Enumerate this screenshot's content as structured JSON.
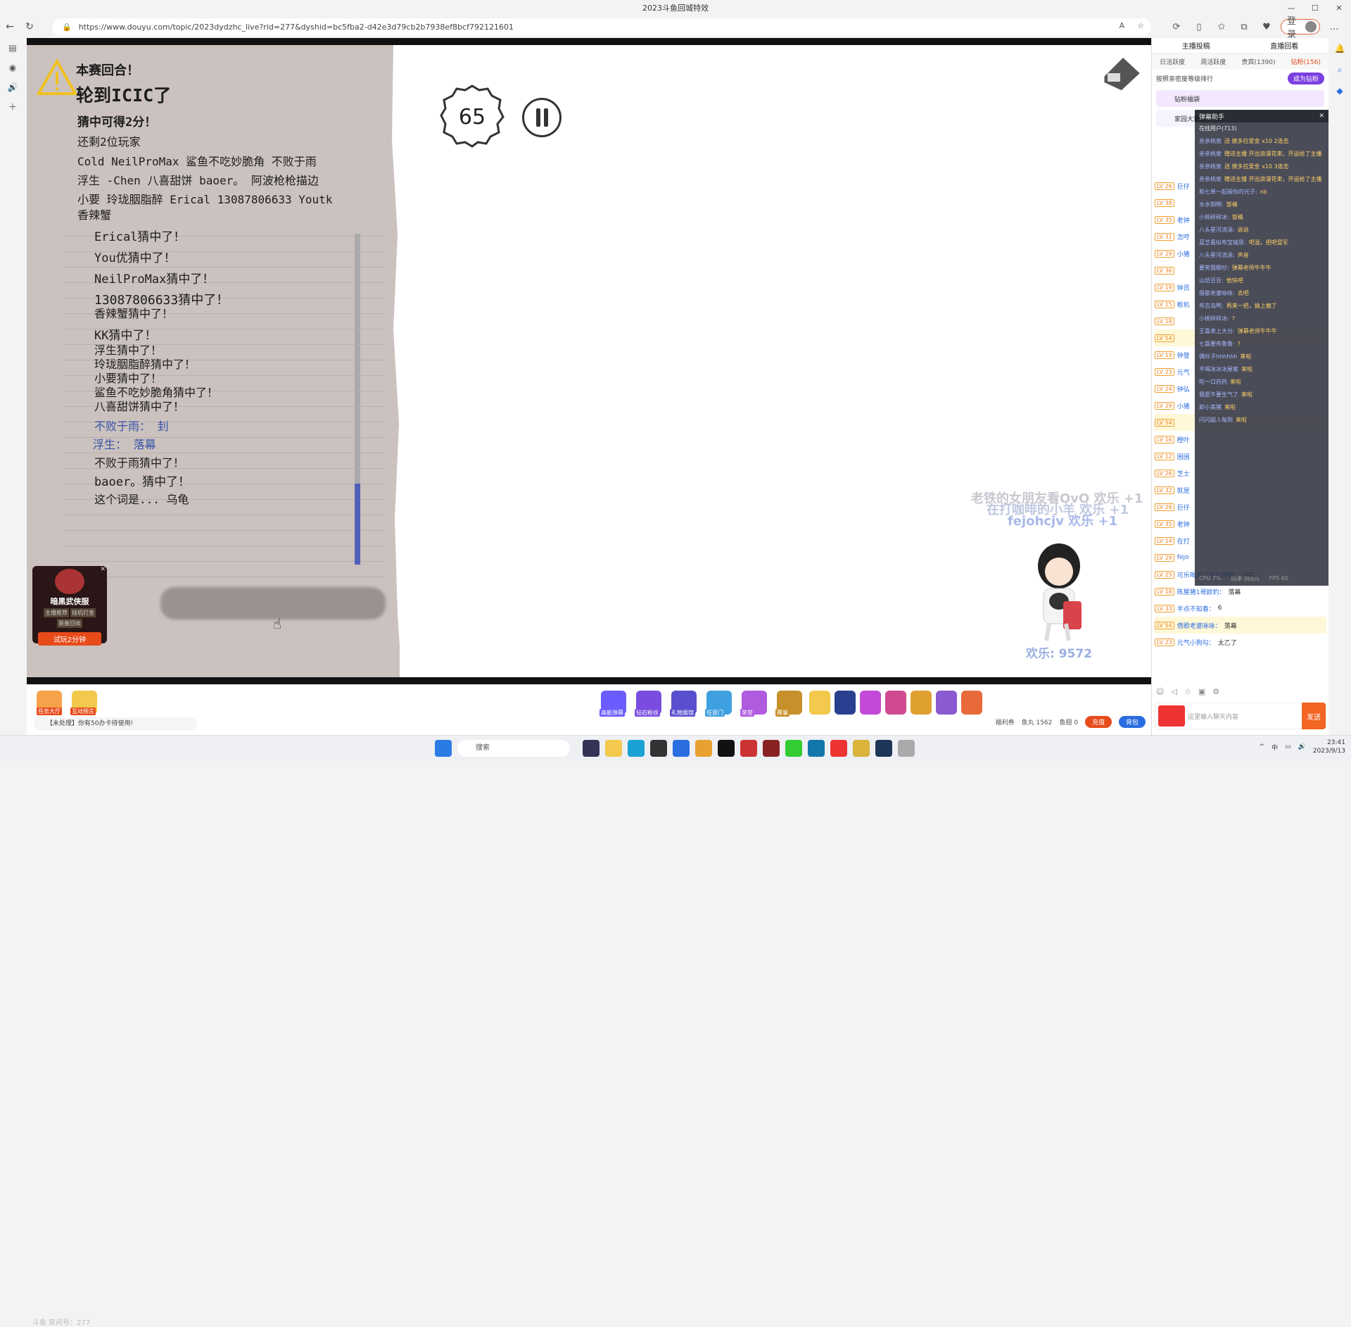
{
  "window": {
    "title": "2023斗鱼回城特效"
  },
  "browser": {
    "url": "https://www.douyu.com/topic/2023dydzhc_live?rid=277&dyshid=bc5fba2-d42e3d79cb2b7938ef8bcf792121601",
    "login_label": "登录"
  },
  "game": {
    "round_label": "本赛回合！",
    "turn": "轮到ICIC了",
    "score_hint": "猜中可得2分！",
    "remaining": "还剩2位玩家",
    "players_line1": "Cold NeilProMax 鲨鱼不吃妙脆角 不败于雨",
    "players_line2": "浮生 -Chen 八喜甜饼 baoer。 阿波枪枪描边",
    "players_line3": "小要 玲珑胭脂醉 Erical 13087806633 Youtk",
    "players_line4": "香辣蟹",
    "log": [
      {
        "text": "Erical猜中了！",
        "style": "normal"
      },
      {
        "text": "You优猜中了！",
        "style": "normal"
      },
      {
        "text": "NeilProMax猜中了！",
        "style": "normal"
      },
      {
        "text": "13087806633猜中了！",
        "style": "normal"
      },
      {
        "text": "香辣蟹猜中了！",
        "style": "normal"
      },
      {
        "text": "KK猜中了！",
        "style": "normal"
      },
      {
        "text": "浮生猜中了！",
        "style": "normal"
      },
      {
        "text": "玲珑胭脂醉猜中了！",
        "style": "normal"
      },
      {
        "text": "小要猜中了！",
        "style": "normal"
      },
      {
        "text": "鲨鱼不吃妙脆角猜中了！",
        "style": "normal"
      },
      {
        "text": "八喜甜饼猜中了！",
        "style": "normal"
      },
      {
        "text": "不败于雨： 刲",
        "style": "blue"
      },
      {
        "text": "浮生： 落幕",
        "style": "blue"
      },
      {
        "text": "不败于雨猜中了！",
        "style": "normal"
      },
      {
        "text": "baoer。猜中了！",
        "style": "normal"
      },
      {
        "text": "这个词是... 乌龟",
        "style": "normal"
      }
    ],
    "timer_value": "65",
    "room_label": "斗鱼 房间号：277"
  },
  "ad": {
    "title": "暗黑武侠服",
    "tag1": "主播推荐",
    "tag2": "挂机打金",
    "tag3": "装备回收",
    "cta": "试玩2分钟"
  },
  "overlay_danmu": [
    {
      "text": "老铁的女朋友看OvO 欢乐 +1",
      "color": "#c8c8d0"
    },
    {
      "text": "在打咖啡的小羊 欢乐 +1",
      "color": "#c0c8e0"
    },
    {
      "text": "fejohcjv 欢乐 +1",
      "color": "#a8b8e8"
    }
  ],
  "cheer": {
    "label": "欢乐: 9572"
  },
  "bottom": {
    "task_label": "任务大厅",
    "interact_label": "互动预言",
    "notice": "【未处理】你有50办卡待使用!",
    "gift_labels": [
      "高能弹幕",
      "钻石粉丝",
      "礼物展馆",
      "任意门",
      "荣誉",
      "赛事"
    ],
    "fish_ball": "鱼丸 1562",
    "fish_wing": "鱼翅 0",
    "benefits": "福利券",
    "recharge": "充值",
    "backpack": "背包"
  },
  "sidebar": {
    "top_links": [
      "主播投稿",
      "直播回看"
    ],
    "tabs": [
      "日活跃度",
      "周活跃度",
      "贵宾(1390)",
      "钻粉(156)"
    ],
    "rank_hint": "按照亲密度等级排行",
    "become_fan": "成为钻粉",
    "fan_rows": [
      "钻粉福袋",
      "家园大家伙"
    ],
    "chat": [
      {
        "lv": "LV 26",
        "nick": "巨仔",
        "msg": ""
      },
      {
        "lv": "LV 38",
        "nick": "",
        "msg": ""
      },
      {
        "lv": "LV 35",
        "nick": "老钟",
        "msg": ""
      },
      {
        "lv": "LV 31",
        "nick": "怎哼",
        "msg": ""
      },
      {
        "lv": "LV 29",
        "nick": "小猪",
        "msg": ""
      },
      {
        "lv": "LV 36",
        "nick": "",
        "msg": ""
      },
      {
        "lv": "LV 19",
        "nick": "钟员",
        "msg": ""
      },
      {
        "lv": "LV 15",
        "nick": "枢机",
        "msg": ""
      },
      {
        "lv": "LV 18",
        "nick": "",
        "msg": ""
      },
      {
        "lv": "LV 54",
        "nick": "",
        "msg": ""
      },
      {
        "lv": "LV 19",
        "nick": "钟登",
        "msg": ""
      },
      {
        "lv": "LV 23",
        "nick": "元气",
        "msg": ""
      },
      {
        "lv": "LV 24",
        "nick": "钟弘",
        "msg": ""
      },
      {
        "lv": "LV 29",
        "nick": "小猪",
        "msg": ""
      },
      {
        "lv": "LV 54",
        "nick": "",
        "msg": ""
      },
      {
        "lv": "LV 16",
        "nick": "橙叶",
        "msg": ""
      },
      {
        "lv": "LV 12",
        "nick": "困困",
        "msg": ""
      },
      {
        "lv": "LV 26",
        "nick": "芝士",
        "msg": ""
      },
      {
        "lv": "LV 32",
        "nick": "就是",
        "msg": ""
      },
      {
        "lv": "LV 26",
        "nick": "巨仔",
        "msg": ""
      },
      {
        "lv": "LV 35",
        "nick": "老钟",
        "msg": ""
      },
      {
        "lv": "LV 14",
        "nick": "在打",
        "msg": ""
      },
      {
        "lv": "LV 29",
        "nick": "fejo",
        "msg": ""
      },
      {
        "lv": "LV 25",
        "nick": "可乐喝多了牙会掉啊：",
        "msg": "ccc"
      },
      {
        "lv": "LV 18",
        "nick": "陈屋猪1哥欧豹：",
        "msg": "落幕"
      },
      {
        "lv": "LV 33",
        "nick": "半点不知春：",
        "msg": "6"
      },
      {
        "lv": "LV 54",
        "nick": "借歌老婆咏咏：",
        "msg": "落幕"
      },
      {
        "lv": "LV 23",
        "nick": "元气小狗勾：",
        "msg": "太乙了"
      }
    ],
    "input_placeholder": "这里输入聊天内容",
    "send": "发送"
  },
  "overlay": {
    "title": "弹幕助手",
    "online": "在线用户(713)",
    "rows": [
      {
        "u": "亲亲桃泉",
        "m": "送 擦多拉爱金 x10 2连击"
      },
      {
        "u": "亲亲桃泉",
        "m": "赠送主播 开出浪漫花束，开运给了主播"
      },
      {
        "u": "亲亲桃泉",
        "m": "送 擦多拉爱金 x10 3连击"
      },
      {
        "u": "亲亲桃泉",
        "m": "赠送主播 开出浪漫花束，开运给了主播"
      },
      {
        "u": "和七单一起碳你的元子:",
        "m": "nb"
      },
      {
        "u": "水水铜啊:",
        "m": "饭桶"
      },
      {
        "u": "小桃碎碎冰:",
        "m": "饭桶"
      },
      {
        "u": "八头星河流淌:",
        "m": "说说"
      },
      {
        "u": "蓝芝看似布宝城思:",
        "m": "吧温，把吧冒军"
      },
      {
        "u": "八头星河流淌:",
        "m": "声音"
      },
      {
        "u": "要笑我眼吵:",
        "m": "弹幕老师牛牛牛"
      },
      {
        "u": "山坊豆豆:",
        "m": "他快吧"
      },
      {
        "u": "借歌老婆咏咏:",
        "m": "去吧"
      },
      {
        "u": "布吉岛鸭:",
        "m": "再来一把，搞上瘾了"
      },
      {
        "u": "小桃碎碎冰:",
        "m": "?"
      },
      {
        "u": "王喜表上大分:",
        "m": "弹幕老师牛牛牛"
      },
      {
        "u": "七喜要布鲁鲁:",
        "m": "?"
      },
      {
        "u": "偶咔子hhhhhh",
        "m": "来啦"
      },
      {
        "u": "不喝冰冰冰屋客",
        "m": "来啦"
      },
      {
        "u": "吃一口药药",
        "m": "来啦"
      },
      {
        "u": "我愿不要生气了",
        "m": "来啦"
      },
      {
        "u": "卸小美猪",
        "m": "来啦"
      },
      {
        "u": "闪闪超人每到",
        "m": "来啦"
      }
    ],
    "foot": [
      "CPU 7%",
      "码率 0kb/s",
      "FPS 60"
    ]
  },
  "taskbar": {
    "search": "搜索",
    "time": "23:41",
    "date": "2023/9/13",
    "ime": "中"
  }
}
